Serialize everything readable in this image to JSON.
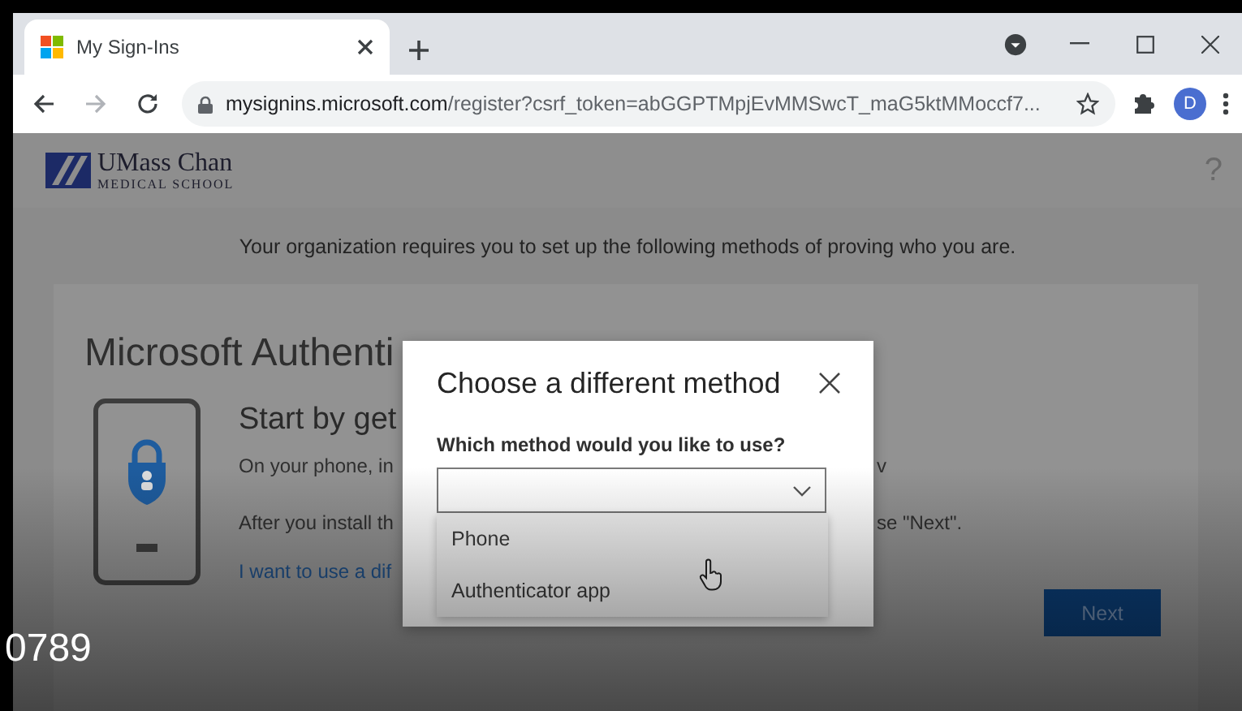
{
  "browser": {
    "tab": {
      "title": "My Sign-Ins"
    },
    "address_bar": {
      "domain": "mysignins.microsoft.com",
      "path": "/register?csrf_token=abGGPTMpjEvMMSwcT_maG5ktMMoccf7..."
    },
    "profile": "D"
  },
  "page": {
    "logo": {
      "name": "UMass Chan",
      "subtitle": "MEDICAL SCHOOL"
    },
    "help": "?",
    "intro": "Your organization requires you to set up the following methods of proving who you are.",
    "card": {
      "title": "Microsoft Authenti",
      "heading": "Start by get",
      "lines": [
        {
          "left": "On your phone, in",
          "right": "v"
        },
        {
          "left": "After you install th",
          "right": "se \"Next\"."
        }
      ],
      "link": "I want to use a dif",
      "next_button": "Next"
    }
  },
  "dialog": {
    "title": "Choose a different method",
    "label": "Which method would you like to use?",
    "options": [
      {
        "label": "Phone",
        "selected": false
      },
      {
        "label": "Authenticator app",
        "selected": false
      }
    ]
  },
  "video_overlay": {
    "timestamp": "0789"
  }
}
